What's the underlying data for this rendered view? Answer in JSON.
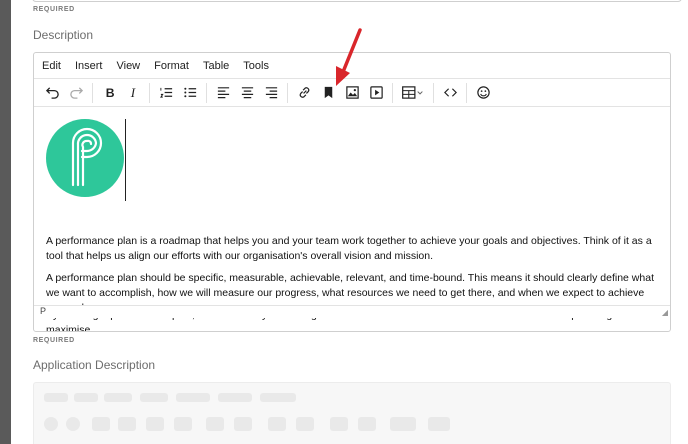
{
  "top_required": "REQUIRED",
  "description_label": "Description",
  "menus": [
    "Edit",
    "Insert",
    "View",
    "Format",
    "Table",
    "Tools"
  ],
  "toolbar_icons": [
    "undo-icon",
    "redo-icon",
    "bold-icon",
    "italic-icon",
    "numbered-list-icon",
    "bullet-list-icon",
    "align-left-icon",
    "align-center-icon",
    "align-right-icon",
    "link-icon",
    "bookmark-icon",
    "image-icon",
    "media-icon",
    "table-icon",
    "code-icon",
    "emoji-icon"
  ],
  "content": {
    "p1": "A performance plan is a roadmap that helps you and your team work together to achieve your goals and objectives. Think of it as a tool that helps us align our efforts with our organisation's overall vision and mission.",
    "p2": "A performance plan should be specific, measurable, achievable, relevant, and time-bound. This means it should clearly define what we want to accomplish, how we will measure our progress, what resources we need to get there, and when we expect to achieve our goals.",
    "p3": "By creating a performance plan, we can identify the strengths and weaknesses of each team member and develop strategies to maximise"
  },
  "status_path": "P",
  "bottom_required": "REQUIRED",
  "application_label": "Application Description",
  "colors": {
    "logo": "#2ec79a",
    "arrow": "#d9262b"
  }
}
